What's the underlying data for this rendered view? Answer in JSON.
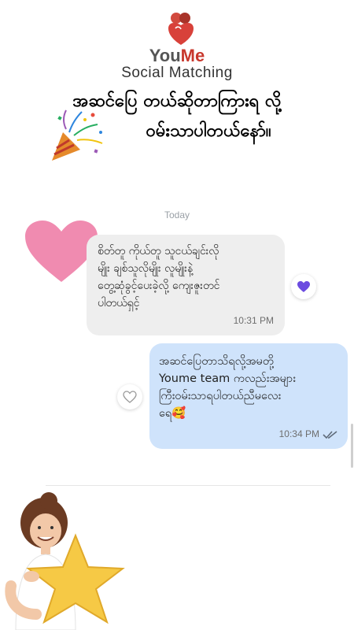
{
  "brand": {
    "name_part1": "You",
    "name_part2": "Me",
    "tagline": "Social Matching"
  },
  "headline": {
    "line1": "အဆင်ပြေ တယ်ဆိုတာကြားရ လို့",
    "line2": "ဝမ်းသာပါတယ်နော်။"
  },
  "chat": {
    "date_separator": "Today",
    "messages": [
      {
        "direction": "incoming",
        "text": "စိတ်တူ ကိုယ်တူ သူငယ်ချင်းလို\nမျိုး ချစ်သူလိုမျိုး လူမျိုးနဲ့\nတွေ့ဆုံခွင့်ပေးခဲ့လို့ ကျေးဇူးတင်\nပါတယ်ရှင့်",
        "time": "10:31 PM",
        "reaction": "purple-heart-icon"
      },
      {
        "direction": "outgoing",
        "text": "အဆင်ပြေတာသိရလို့အမတို့\nYoume team ကလည်းအများ\nကြီးဝမ်းသာရပါတယ်ညီမလေး\nရေ🥰",
        "time": "10:34 PM",
        "status": "read-double-check-icon",
        "reaction": "outline-heart-icon"
      }
    ]
  },
  "colors": {
    "brand_red": "#c8382d",
    "incoming_bubble": "#eeeeee",
    "outgoing_bubble": "#cfe3fb",
    "reaction_purple": "#6b4be0",
    "big_heart": "#f08bb0"
  }
}
